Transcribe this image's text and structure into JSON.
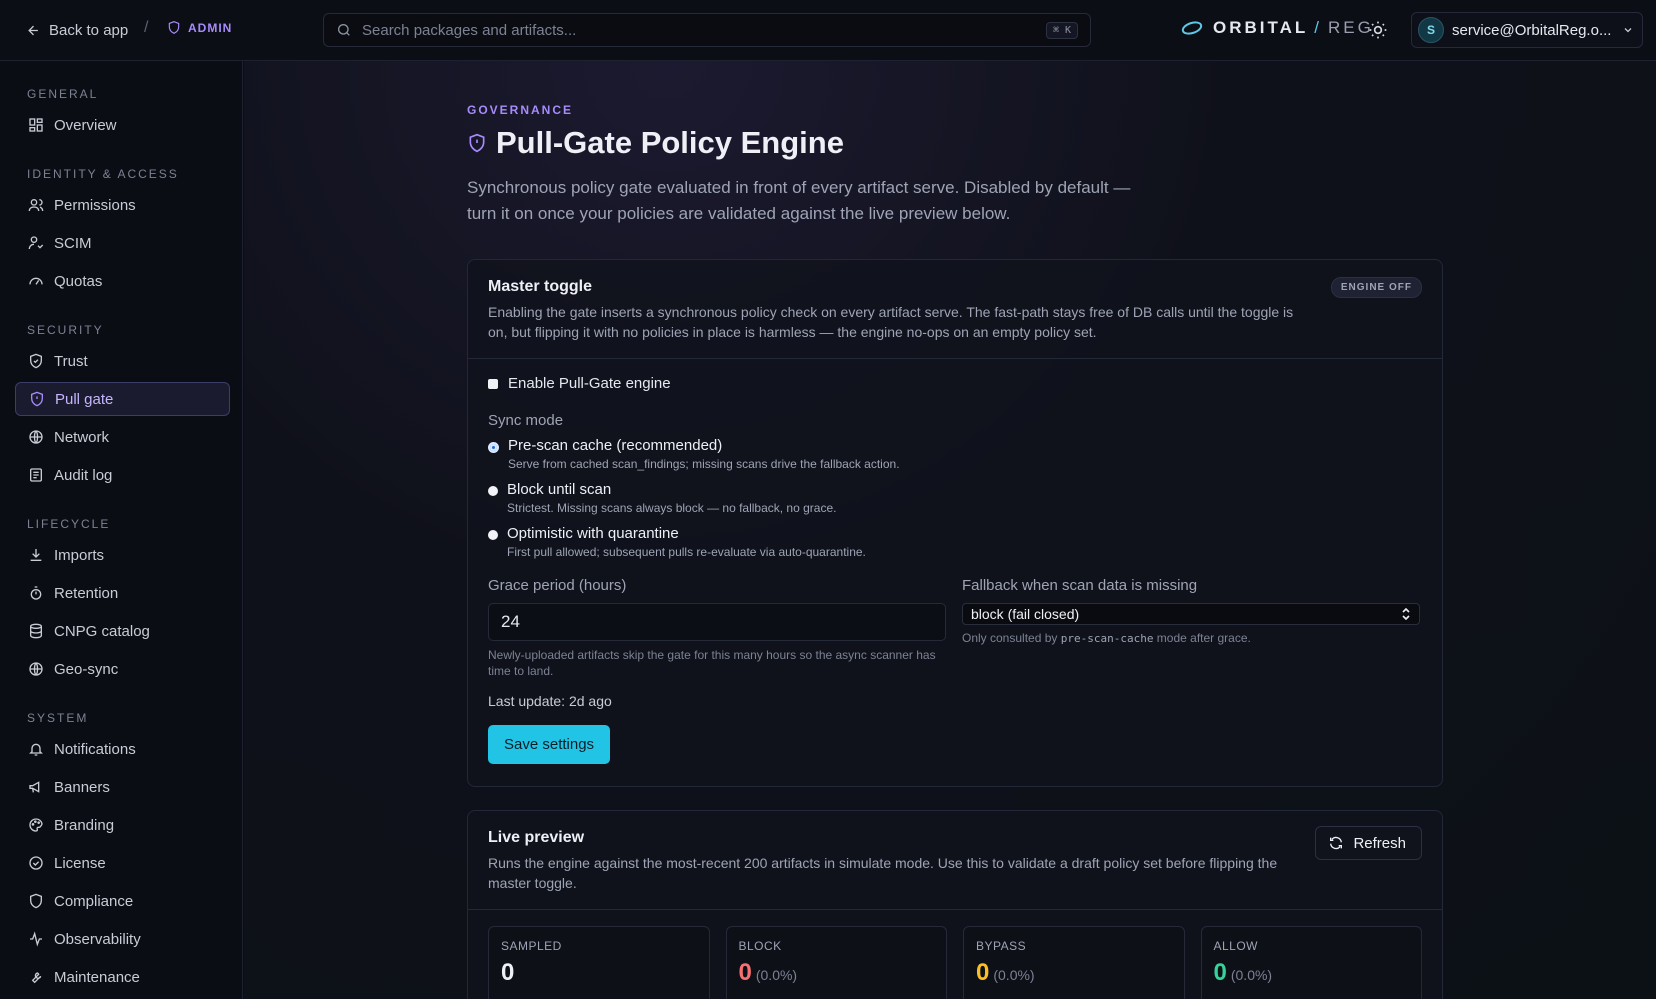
{
  "topbar": {
    "back_label": "Back to app",
    "separator": "/",
    "admin_label": "ADMIN",
    "search_placeholder": "Search packages and artifacts...",
    "search_shortcut": "⌘ K",
    "brand_name": "ORBITAL",
    "brand_slash": "/",
    "brand_suffix": "REG",
    "account_initial": "S",
    "account_label": "service@OrbitalReg.o..."
  },
  "sidebar": {
    "sections": [
      {
        "title": "GENERAL",
        "items": [
          {
            "label": "Overview",
            "icon": "grid-icon"
          }
        ]
      },
      {
        "title": "IDENTITY & ACCESS",
        "items": [
          {
            "label": "Permissions",
            "icon": "users-icon"
          },
          {
            "label": "SCIM",
            "icon": "user-sync-icon"
          },
          {
            "label": "Quotas",
            "icon": "gauge-icon"
          }
        ]
      },
      {
        "title": "SECURITY",
        "items": [
          {
            "label": "Trust",
            "icon": "shield-check-icon"
          },
          {
            "label": "Pull gate",
            "icon": "shield-icon",
            "active": true
          },
          {
            "label": "Network",
            "icon": "globe-icon"
          },
          {
            "label": "Audit log",
            "icon": "log-icon"
          }
        ]
      },
      {
        "title": "LIFECYCLE",
        "items": [
          {
            "label": "Imports",
            "icon": "download-icon"
          },
          {
            "label": "Retention",
            "icon": "timer-icon"
          },
          {
            "label": "CNPG catalog",
            "icon": "database-icon"
          },
          {
            "label": "Geo-sync",
            "icon": "globe-icon"
          }
        ]
      },
      {
        "title": "SYSTEM",
        "items": [
          {
            "label": "Notifications",
            "icon": "bell-icon"
          },
          {
            "label": "Banners",
            "icon": "megaphone-icon"
          },
          {
            "label": "Branding",
            "icon": "palette-icon"
          },
          {
            "label": "License",
            "icon": "badge-check-icon"
          },
          {
            "label": "Compliance",
            "icon": "shield-icon"
          },
          {
            "label": "Observability",
            "icon": "activity-icon"
          },
          {
            "label": "Maintenance",
            "icon": "wrench-icon"
          }
        ]
      }
    ]
  },
  "page": {
    "eyebrow": "GOVERNANCE",
    "title": "Pull-Gate Policy Engine",
    "subtitle": "Synchronous policy gate evaluated in front of every artifact serve. Disabled by default — turn it on once your policies are validated against the live preview below."
  },
  "master": {
    "title": "Master toggle",
    "badge": "ENGINE OFF",
    "description": "Enabling the gate inserts a synchronous policy check on every artifact serve. The fast-path stays free of DB calls until the toggle is on, but flipping it with no policies in place is harmless — the engine no-ops on an empty policy set.",
    "enable_label": "Enable Pull-Gate engine",
    "sync_mode_label": "Sync mode",
    "modes": [
      {
        "label": "Pre-scan cache (recommended)",
        "hint": "Serve from cached scan_findings; missing scans drive the fallback action.",
        "selected": true
      },
      {
        "label": "Block until scan",
        "hint": "Strictest. Missing scans always block — no fallback, no grace.",
        "selected": false
      },
      {
        "label": "Optimistic with quarantine",
        "hint": "First pull allowed; subsequent pulls re-evaluate via auto-quarantine.",
        "selected": false
      }
    ],
    "grace_label": "Grace period (hours)",
    "grace_value": "24",
    "grace_hint": "Newly-uploaded artifacts skip the gate for this many hours so the async scanner has time to land.",
    "fallback_label": "Fallback when scan data is missing",
    "fallback_value": "block (fail closed)",
    "fallback_hint_prefix": "Only consulted by",
    "fallback_hint_code": "pre-scan-cache",
    "fallback_hint_suffix": "mode after grace.",
    "last_update": "Last update: 2d ago",
    "save_label": "Save settings"
  },
  "preview": {
    "title": "Live preview",
    "description": "Runs the engine against the most-recent 200 artifacts in simulate mode. Use this to validate a draft policy set before flipping the master toggle.",
    "refresh_label": "Refresh",
    "stats": [
      {
        "label": "SAMPLED",
        "value": "0",
        "pct": "",
        "color": "#eef0f6"
      },
      {
        "label": "BLOCK",
        "value": "0",
        "pct": "(0.0%)",
        "color": "#f87171"
      },
      {
        "label": "BYPASS",
        "value": "0",
        "pct": "(0.0%)",
        "color": "#fbbf24"
      },
      {
        "label": "ALLOW",
        "value": "0",
        "pct": "(0.0%)",
        "color": "#34d399"
      }
    ]
  },
  "colors": {
    "accent": "#a78bfa",
    "primary_button": "#22c4e6"
  }
}
